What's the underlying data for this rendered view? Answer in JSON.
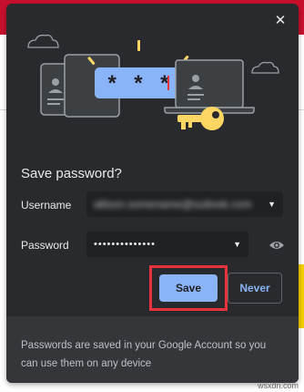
{
  "dialog": {
    "title": "Save password?",
    "close_icon": "close-icon"
  },
  "illustration": {
    "masked_password": "* * *"
  },
  "username": {
    "label": "Username",
    "value": "allison.somename@outlook.com"
  },
  "password": {
    "label": "Password",
    "value": "••••••••••••••"
  },
  "buttons": {
    "save": "Save",
    "never": "Never"
  },
  "footer": {
    "text": "Passwords are saved in your Google Account so you can use them on any device"
  },
  "watermark": "wsxdn.com",
  "colors": {
    "dialog_bg": "#292a2d",
    "accent": "#8ab4f8",
    "key_yellow": "#fdd663",
    "highlight_red": "#e8323c"
  }
}
